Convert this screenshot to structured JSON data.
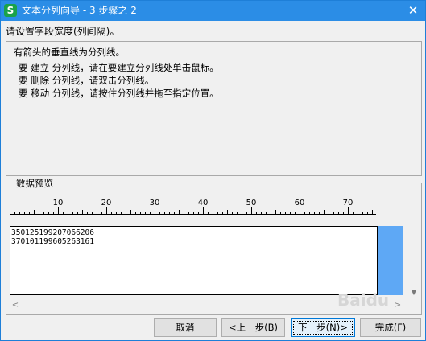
{
  "window": {
    "title": "文本分列向导 - 3 步骤之 2",
    "app_icon_glyph": "S",
    "close_glyph": "✕"
  },
  "instruction": "请设置字段宽度(列间隔)。",
  "help": {
    "line1": "有箭头的垂直线为分列线。",
    "line2": "要 建立 分列线，请在要建立分列线处单击鼠标。",
    "line3": "要 删除 分列线，请双击分列线。",
    "line4": "要 移动 分列线，请按住分列线并拖至指定位置。"
  },
  "preview": {
    "label": "数据预览",
    "ruler_ticks": [
      "10",
      "20",
      "30",
      "40",
      "50",
      "60",
      "70"
    ],
    "rows": [
      "350125199207066206",
      "370101199605263161"
    ]
  },
  "scroll": {
    "left_glyph": "<",
    "right_glyph": ">",
    "down_glyph": "▼"
  },
  "buttons": {
    "cancel": "取消",
    "back": "<上一步(B)",
    "next": "下一步(N)>",
    "finish": "完成(F)"
  },
  "watermark": "Baidu"
}
